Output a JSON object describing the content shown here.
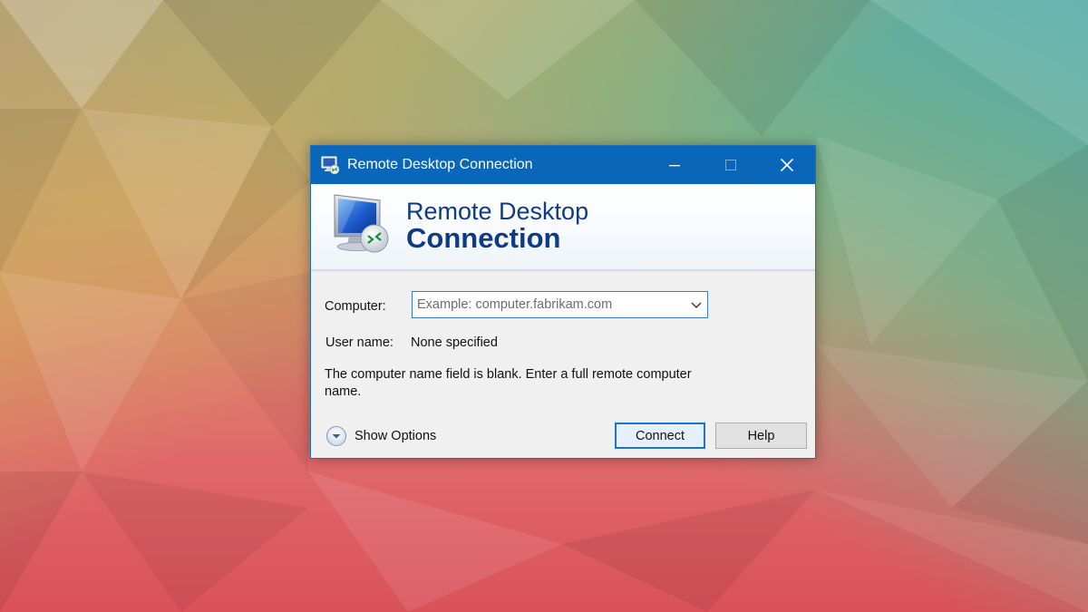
{
  "window": {
    "title": "Remote Desktop Connection",
    "controls": {
      "minimize_icon": "minimize-icon",
      "maximize_icon": "maximize-icon",
      "close_icon": "close-icon"
    }
  },
  "banner": {
    "line1": "Remote Desktop",
    "line2": "Connection",
    "icon": "remote-desktop-monitor-icon"
  },
  "form": {
    "computer_label": "Computer:",
    "computer_value": "",
    "computer_placeholder": "Example: computer.fabrikam.com",
    "username_label": "User name:",
    "username_value": "None specified",
    "message": "The computer name field is blank. Enter a full remote computer name."
  },
  "footer": {
    "show_options_label": "Show Options",
    "show_options_icon": "chevron-down-circle-icon",
    "connect_label": "Connect",
    "help_label": "Help"
  },
  "colors": {
    "titlebar": "#0a66b8",
    "banner_text": "#0f3a84",
    "window_bg": "#f0f0f0",
    "focus_border": "#1a73d0"
  }
}
